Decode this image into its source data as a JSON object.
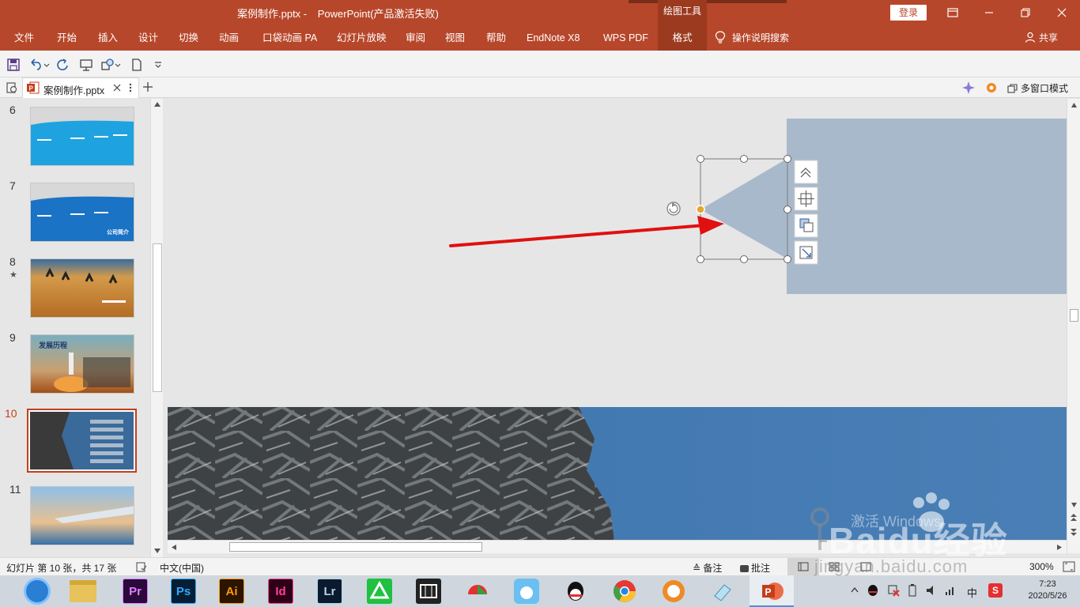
{
  "window": {
    "doc_title": "案例制作.pptx",
    "app_title": "PowerPoint(产品激活失败)",
    "contextual_tools": "绘图工具",
    "login": "登录"
  },
  "ribbon": {
    "tabs": [
      "文件",
      "开始",
      "插入",
      "设计",
      "切换",
      "动画",
      "口袋动画 PA",
      "幻灯片放映",
      "审阅",
      "视图",
      "帮助",
      "EndNote X8",
      "WPS PDF",
      "格式"
    ],
    "search": "操作说明搜索",
    "share": "共享"
  },
  "tabstrip": {
    "doc_tab": "案例制作.pptx",
    "multi_window": "多窗口模式"
  },
  "thumbnails": [
    {
      "num": "6",
      "star": false
    },
    {
      "num": "7",
      "star": false,
      "caption": "公司简介"
    },
    {
      "num": "8",
      "star": true
    },
    {
      "num": "9",
      "star": false,
      "caption": "发展历程"
    },
    {
      "num": "10",
      "star": false,
      "active": true
    },
    {
      "num": "11",
      "star": false
    }
  ],
  "statusbar": {
    "slide_info": "幻灯片 第 10 张，共 17 张",
    "language": "中文(中国)",
    "notes": "备注",
    "comments": "批注",
    "zoom": "300%"
  },
  "taskbar": {
    "apps": [
      {
        "name": "Pr",
        "color": "#2a0a3a",
        "fg": "#e27bff"
      },
      {
        "name": "Ps",
        "color": "#061e33",
        "fg": "#31a8ff"
      },
      {
        "name": "Ai",
        "color": "#2b1500",
        "fg": "#ff9a00"
      },
      {
        "name": "Id",
        "color": "#2e0017",
        "fg": "#ff3f96"
      },
      {
        "name": "Lr",
        "color": "#0b1a2c",
        "fg": "#add5ec"
      }
    ],
    "time": "7:23",
    "date": "2020/5/26",
    "ime": "中"
  },
  "watermark": {
    "brand": "Baidu经验",
    "sub": "激活 Windows",
    "url": "jingyan.baidu.com"
  },
  "colors": {
    "accent": "#b7472a",
    "shape_fill": "#a9b9cc",
    "arrow": "#e01010"
  }
}
